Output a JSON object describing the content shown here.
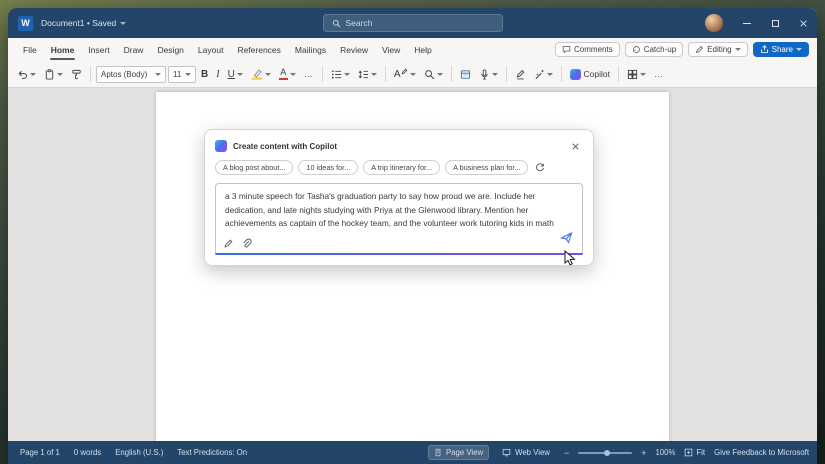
{
  "title_bar": {
    "app_icon": "W",
    "title": "Document1 • Saved",
    "search": "Search"
  },
  "tabs": [
    {
      "label": "File"
    },
    {
      "label": "Home"
    },
    {
      "label": "Insert"
    },
    {
      "label": "Draw"
    },
    {
      "label": "Design"
    },
    {
      "label": "Layout"
    },
    {
      "label": "References"
    },
    {
      "label": "Mailings"
    },
    {
      "label": "Review"
    },
    {
      "label": "View"
    },
    {
      "label": "Help"
    }
  ],
  "tab_actions": {
    "comments": "Comments",
    "catchup": "Catch-up",
    "editing": "Editing",
    "share": "Share"
  },
  "ribbon": {
    "font_name": "Aptos (Body)",
    "font_size": "11",
    "bold": "B",
    "italic": "I",
    "underline": "U",
    "font_color": "A",
    "styles": "A",
    "overflow": "…",
    "copilot": "Copilot"
  },
  "copilot_dialog": {
    "title": "Create content with Copilot",
    "chips": [
      {
        "label": "A blog post about..."
      },
      {
        "label": "10 ideas for..."
      },
      {
        "label": "A trip itinerary for..."
      },
      {
        "label": "A business plan for..."
      }
    ],
    "prompt": "a 3 minute speech for Tasha's graduation party to say how proud we are. Include her dedication, and late nights studying with Priya at the Glenwood library. Mention her achievements as captain of the hockey team, and the volunteer work tutoring kids in math"
  },
  "status_bar": {
    "page_count": "Page 1 of 1",
    "word_count": "0 words",
    "language": "English (U.S.)",
    "text_predictions": "Text Predictions: On",
    "page_view": "Page View",
    "web_view": "Web View",
    "zoom_out": "−",
    "zoom_in": "+",
    "zoom_level": "100%",
    "fit": "Fit",
    "feedback": "Give Feedback to Microsoft"
  }
}
